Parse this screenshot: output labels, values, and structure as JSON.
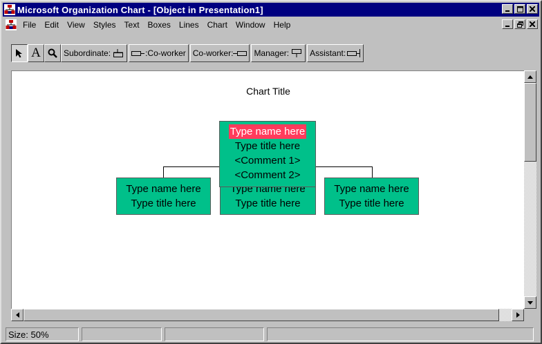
{
  "window": {
    "title": "Microsoft Organization Chart - [Object in Presentation1]",
    "app_icon": "org-chart-icon",
    "controls": {
      "minimize": "_",
      "maximize": "□",
      "close": "×"
    }
  },
  "menubar": {
    "items": [
      {
        "label": "File"
      },
      {
        "label": "Edit"
      },
      {
        "label": "View"
      },
      {
        "label": "Styles"
      },
      {
        "label": "Text"
      },
      {
        "label": "Boxes"
      },
      {
        "label": "Lines"
      },
      {
        "label": "Chart"
      },
      {
        "label": "Window"
      },
      {
        "label": "Help"
      }
    ],
    "doc_controls": {
      "minimize": "_",
      "restore": "❐",
      "close": "×"
    }
  },
  "toolbar": {
    "select_icon": "arrow-pointer-icon",
    "text_tool": "A",
    "zoom_icon": "magnifier-icon",
    "subordinate": "Subordinate:",
    "coworker_left": ":Co-worker",
    "coworker_right": "Co-worker:",
    "manager": "Manager:",
    "assistant": "Assistant:"
  },
  "chart": {
    "title": "Chart Title",
    "manager": {
      "name": "Type name here",
      "title": "Type title here",
      "comment1": "<Comment 1>",
      "comment2": "<Comment 2>"
    },
    "subordinates": [
      {
        "name": "Type name here",
        "title": "Type title here"
      },
      {
        "name": "Type name here",
        "title": "Type title here"
      },
      {
        "name": "Type name here",
        "title": "Type title here"
      }
    ],
    "colors": {
      "box_fill": "#00c08a",
      "selection": "#ff3b5c"
    }
  },
  "status": {
    "size": "Size: 50%"
  }
}
